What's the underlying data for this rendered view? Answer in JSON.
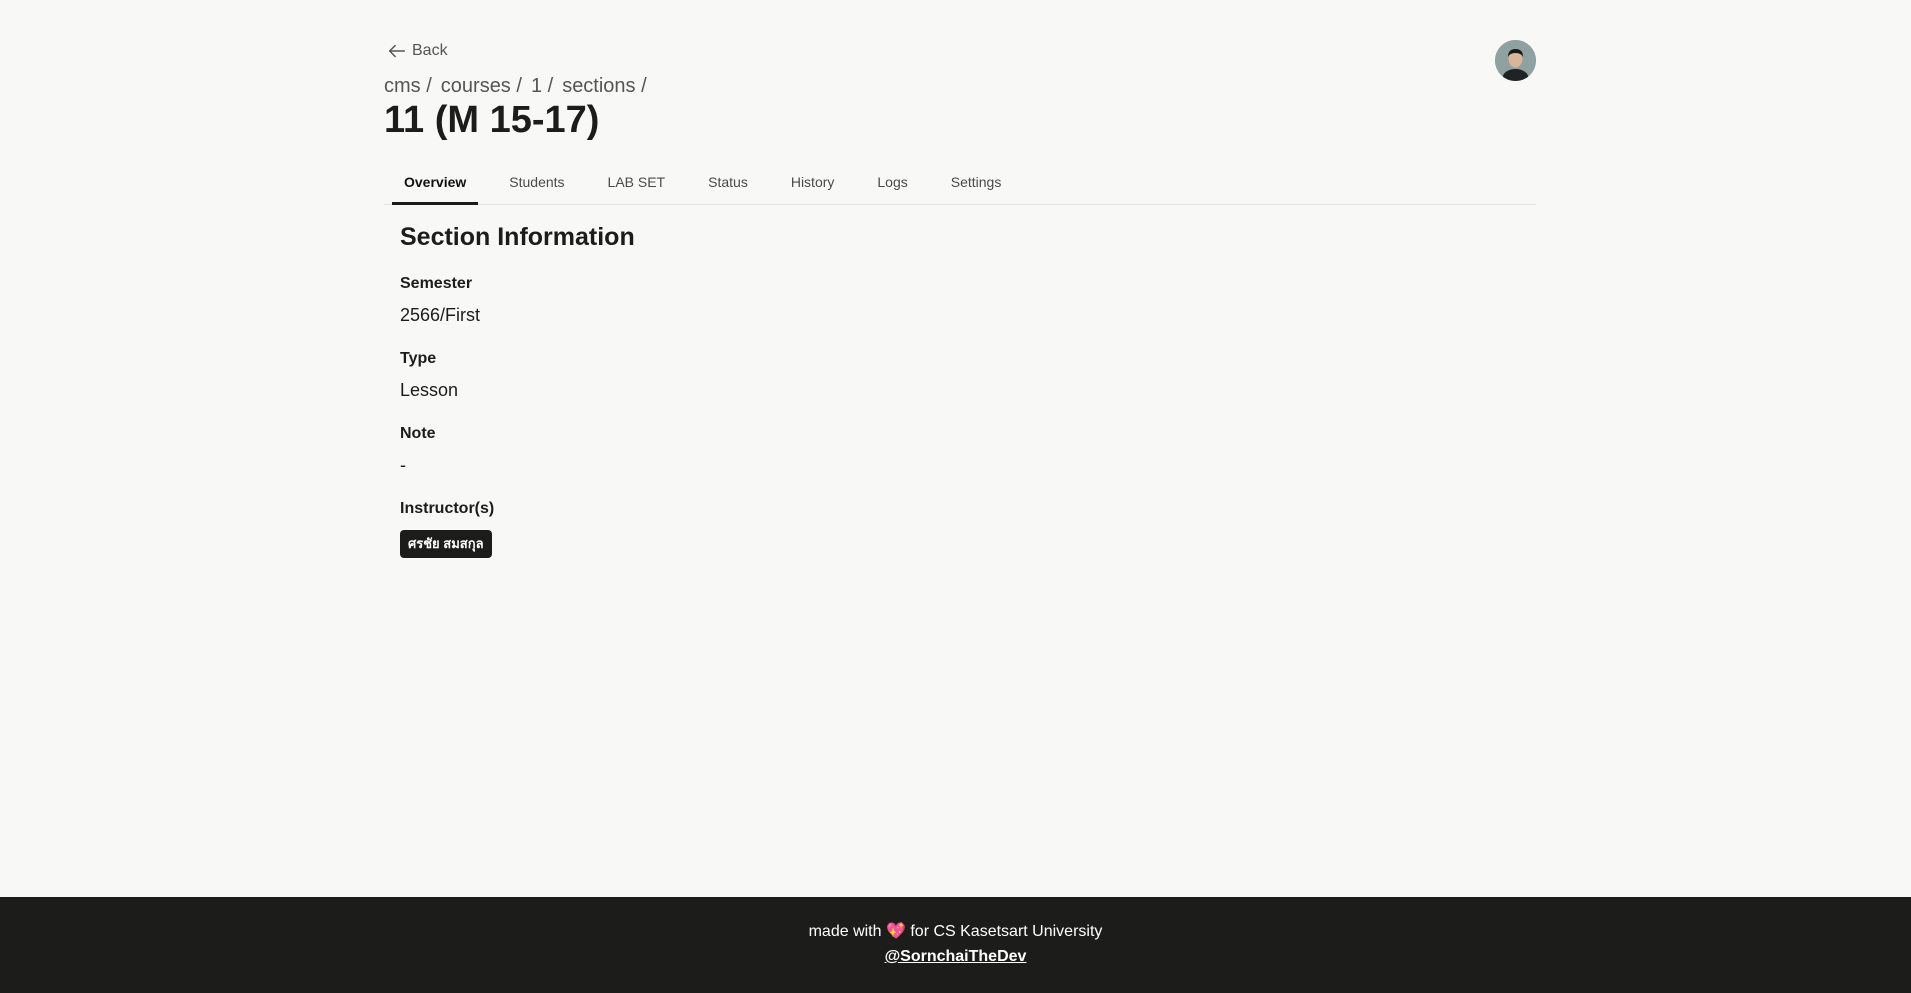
{
  "nav": {
    "back_label": "Back"
  },
  "breadcrumb": {
    "items": [
      "cms /",
      "courses /",
      "1 /",
      "sections /"
    ]
  },
  "page": {
    "title": "11 (M 15-17)"
  },
  "tabs": [
    {
      "label": "Overview",
      "active": true
    },
    {
      "label": "Students",
      "active": false
    },
    {
      "label": "LAB SET",
      "active": false
    },
    {
      "label": "Status",
      "active": false
    },
    {
      "label": "History",
      "active": false
    },
    {
      "label": "Logs",
      "active": false
    },
    {
      "label": "Settings",
      "active": false
    }
  ],
  "section": {
    "title": "Section Information",
    "fields": [
      {
        "label": "Semester",
        "value": "2566/First"
      },
      {
        "label": "Type",
        "value": "Lesson"
      },
      {
        "label": "Note",
        "value": "-"
      }
    ],
    "instructors_label": "Instructor(s)",
    "instructors": [
      "ศรชัย สมสกุล"
    ]
  },
  "footer": {
    "made_with": "made with",
    "heart": "💖",
    "for_text": "for CS Kasetsart University",
    "handle": "@SornchaiTheDev"
  },
  "colors": {
    "background": "#f8f8f6",
    "text": "#1c1c1a",
    "footer_bg": "#1c1c1a",
    "badge_bg": "#1c1c1a"
  }
}
